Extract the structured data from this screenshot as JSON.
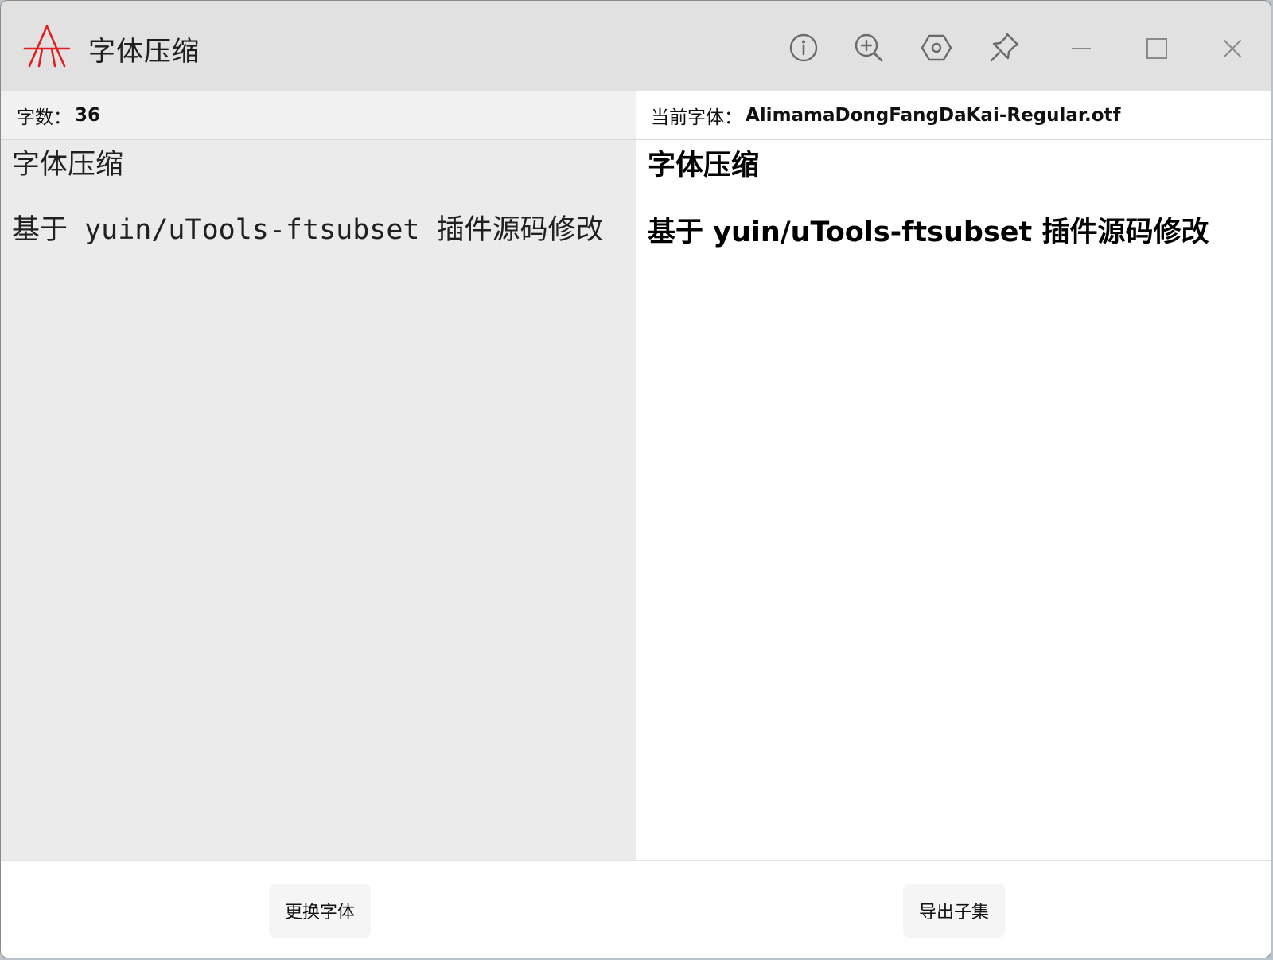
{
  "app": {
    "title": "字体压缩",
    "logo_color": "#e02020"
  },
  "toolbar": {
    "icons": [
      "info-icon",
      "zoom-in-icon",
      "settings-icon",
      "pin-icon"
    ],
    "window_controls": [
      "minimize-icon",
      "maximize-icon",
      "close-icon"
    ]
  },
  "left_panel": {
    "count_label": "字数：",
    "count_value": "36",
    "lines": [
      "字体压缩",
      "基于 yuin/uTools-ftsubset 插件源码修改"
    ]
  },
  "right_panel": {
    "font_label": "当前字体：",
    "font_name": "AlimamaDongFangDaKai-Regular.otf",
    "lines": [
      "字体压缩",
      "基于 yuin/uTools-ftsubset 插件源码修改"
    ]
  },
  "buttons": {
    "change_font": "更换字体",
    "export_subset": "导出子集"
  }
}
